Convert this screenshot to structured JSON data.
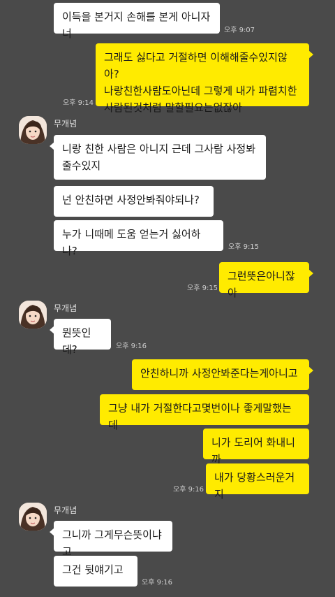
{
  "theme": {
    "bg": "#4a4a4a",
    "incoming": "#ffffff",
    "outgoing": "#ffeb00"
  },
  "sender_name": "무개념",
  "messages": [
    {
      "id": "m1",
      "dir": "in",
      "text": "이득을 본거지 손해를 본게 아니자너",
      "time": "오후 9:07"
    },
    {
      "id": "m2",
      "dir": "out",
      "text": "그래도 싫다고 거절하면 이해해줄수있지않아?\n나랑친한사람도아닌데 그렇게 내가 파렴치한\n사람된것처럼 말할필요는없잖아",
      "time": "오후 9:14"
    },
    {
      "id": "m3",
      "dir": "in",
      "text": "니랑 친한 사람은 아니지 근데 그사람 사정봐\n줄수있지",
      "time": ""
    },
    {
      "id": "m4",
      "dir": "in",
      "text": "넌 안친하면 사정안봐줘야되나?",
      "time": ""
    },
    {
      "id": "m5",
      "dir": "in",
      "text": "누가 니때메 도움 얻는거 싫어하나?",
      "time": "오후 9:15"
    },
    {
      "id": "m6",
      "dir": "out",
      "text": "그런뜻은아니잖아",
      "time": "오후 9:15"
    },
    {
      "id": "m7",
      "dir": "in",
      "text": "뭔뜻인데?",
      "time": "오후 9:16"
    },
    {
      "id": "m8",
      "dir": "out",
      "text": "안친하니까 사정안봐준다는게아니고",
      "time": ""
    },
    {
      "id": "m9",
      "dir": "out",
      "text": "그냥 내가 거절한다고몇번이나 좋게말했는데",
      "time": ""
    },
    {
      "id": "m10",
      "dir": "out",
      "text": "니가 도리어 화내니까",
      "time": ""
    },
    {
      "id": "m11",
      "dir": "out",
      "text": "내가 당황스러운거지",
      "time": "오후 9:16"
    },
    {
      "id": "m12",
      "dir": "in",
      "text": "그니까 그게무슨뜻이냐고",
      "time": ""
    },
    {
      "id": "m13",
      "dir": "in",
      "text": "그건 뒷얘기고",
      "time": "오후 9:16"
    }
  ]
}
